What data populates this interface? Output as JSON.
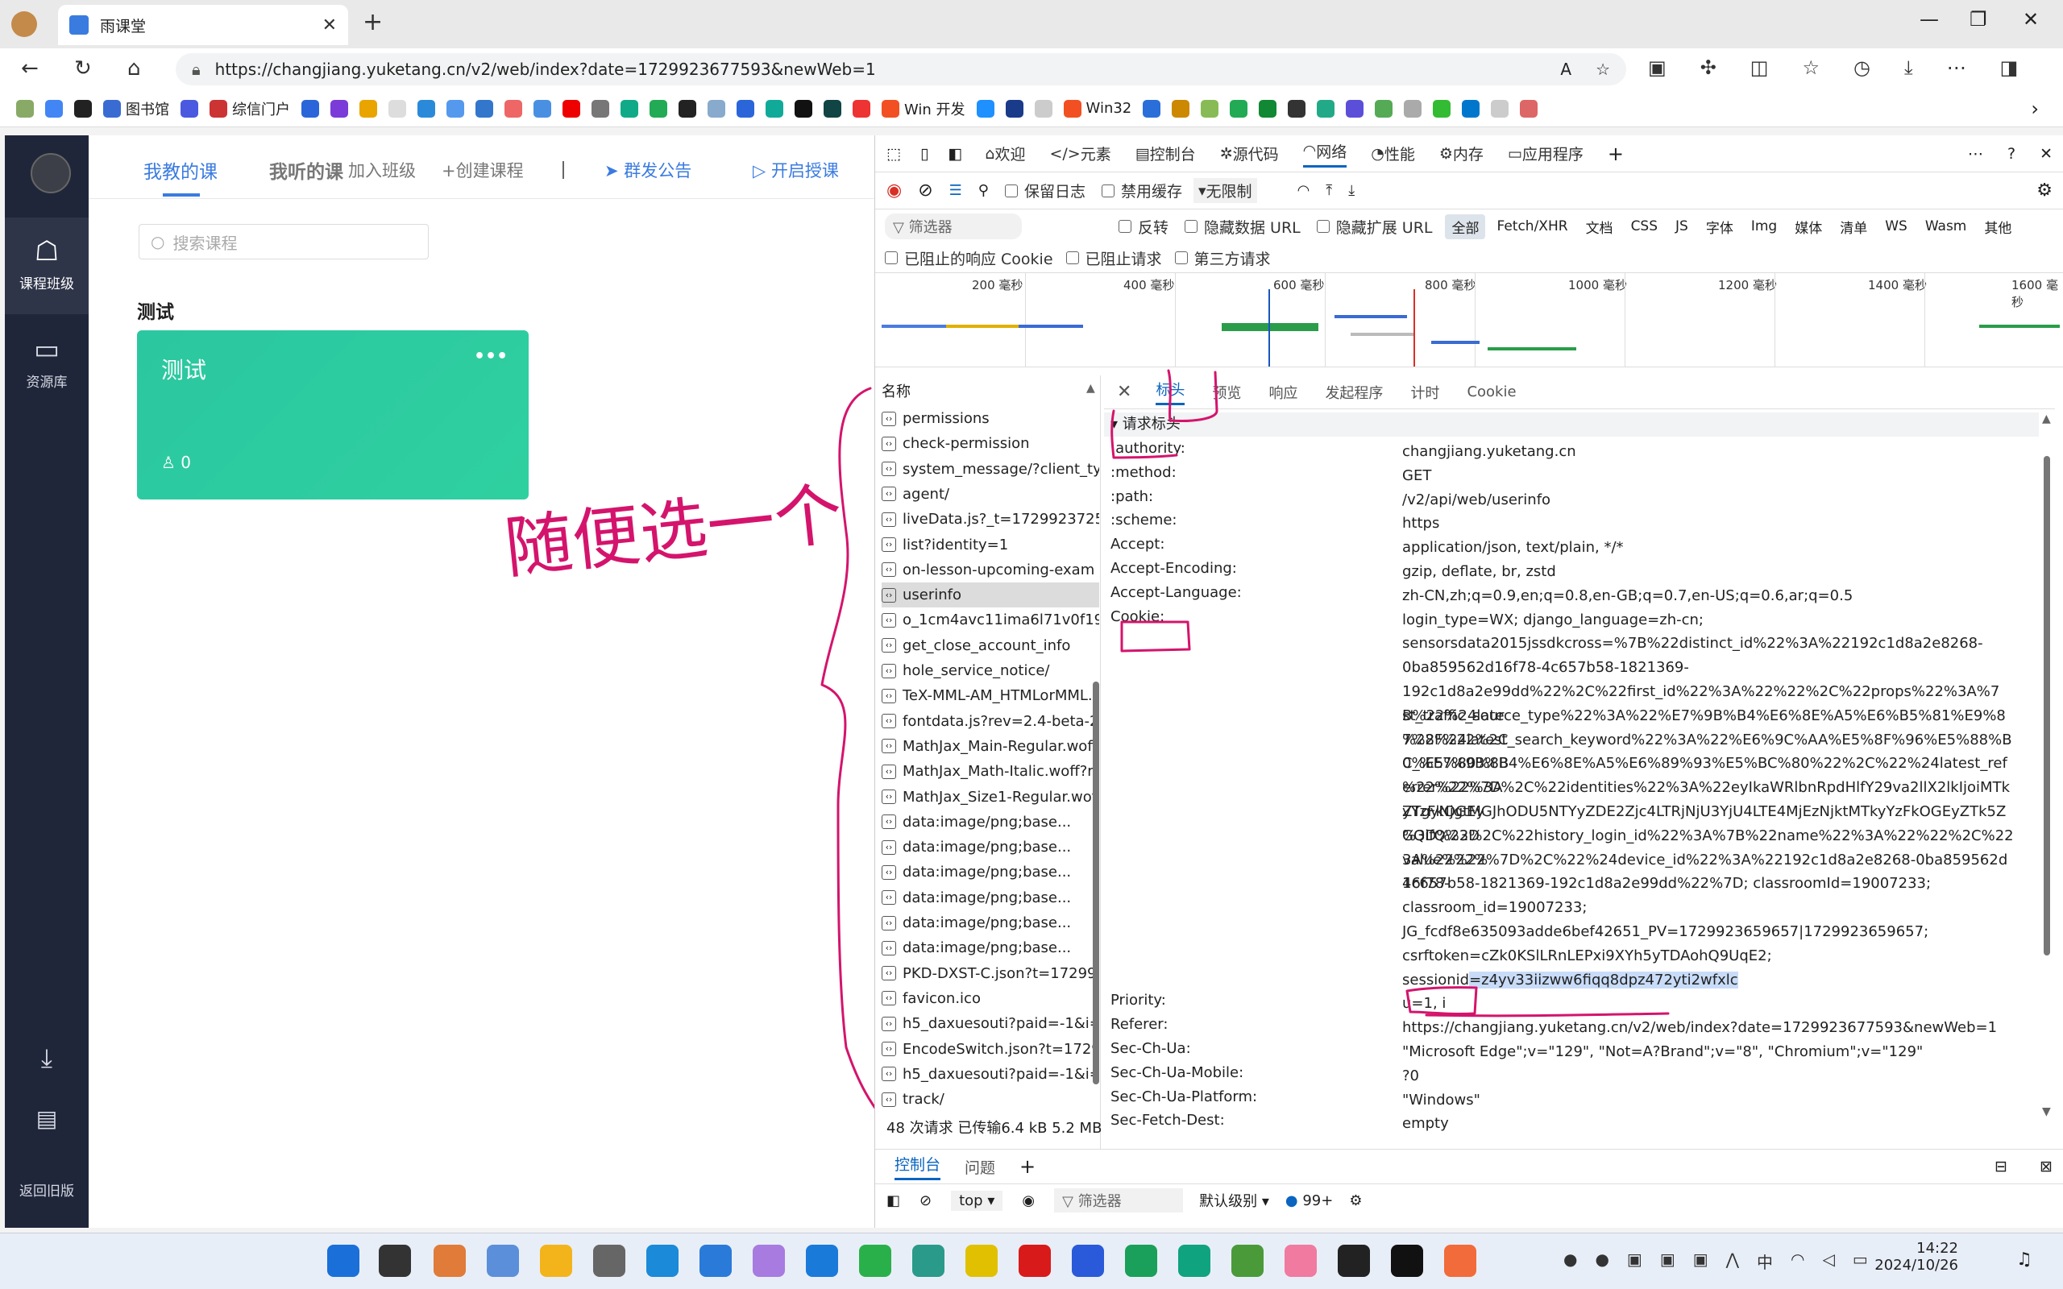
{
  "browser": {
    "tab_title": "雨课堂",
    "url": "https://changjiang.yuketang.cn/v2/web/index?date=1729923677593&newWeb=1",
    "bookmarks": [
      "图书馆",
      "综信门户",
      "Win 开发",
      "Win32"
    ]
  },
  "sidebar": {
    "items": [
      {
        "label": "课程班级"
      },
      {
        "label": "资源库"
      }
    ],
    "back_label": "返回旧版"
  },
  "main": {
    "tabs": [
      "我教的课",
      "我听的课",
      "加入班级",
      "+创建课程",
      "群发公告",
      "开启授课"
    ],
    "search_placeholder": "搜索课程",
    "section_title": "测试",
    "card": {
      "title": "测试",
      "more": "•••",
      "count": "0"
    }
  },
  "annotation": {
    "text": "随便选一个"
  },
  "devtools": {
    "tabs": [
      "欢迎",
      "元素",
      "控制台",
      "源代码",
      "网络",
      "性能",
      "内存",
      "应用程序"
    ],
    "toolbar": {
      "preserve_log": "保留日志",
      "disable_cache": "禁用缓存",
      "throttle": "无限制"
    },
    "filter": {
      "placeholder": "筛选器",
      "invert": "反转",
      "hide_data_url": "隐藏数据 URL",
      "hide_ext_url": "隐藏扩展 URL",
      "types": [
        "全部",
        "Fetch/XHR",
        "文档",
        "CSS",
        "JS",
        "字体",
        "Img",
        "媒体",
        "清单",
        "WS",
        "Wasm",
        "其他"
      ]
    },
    "options": [
      "已阻止的响应 Cookie",
      "已阻止请求",
      "第三方请求"
    ],
    "timeline_labels": [
      "200 毫秒",
      "400 毫秒",
      "600 毫秒",
      "800 毫秒",
      "1000 毫秒",
      "1200 毫秒",
      "1400 毫秒",
      "1600 毫秒"
    ],
    "list_header": "名称",
    "requests": [
      "permissions",
      "check-permission",
      "system_message/?client_typ...",
      "agent/",
      "liveData.js?_t=17299237253...",
      "list?identity=1",
      "on-lesson-upcoming-exam",
      "userinfo",
      "o_1cm4avc11ima6l71v0f19l...",
      "get_close_account_info",
      "hole_service_notice/",
      "TeX-MML-AM_HTMLorMML...",
      "fontdata.js?rev=2.4-beta-2",
      "MathJax_Main-Regular.woff...",
      "MathJax_Math-Italic.woff?re...",
      "MathJax_Size1-Regular.woff...",
      "data:image/png;base...",
      "data:image/png;base...",
      "data:image/png;base...",
      "data:image/png;base...",
      "data:image/png;base...",
      "data:image/png;base...",
      "PKD-DXST-C.json?t=172992...",
      "favicon.ico",
      "h5_daxuesouti?paid=-1&i=...",
      "EncodeSwitch.json?t=17299...",
      "h5_daxuesouti?paid=-1&i=...",
      "track/"
    ],
    "status": "48 次请求  已传输6.4 kB  5.2 MB 条",
    "detail_tabs": [
      "标头",
      "预览",
      "响应",
      "发起程序",
      "计时",
      "Cookie"
    ],
    "section": "请求标头",
    "headers": [
      {
        "name": ":authority:",
        "value": "changjiang.yuketang.cn"
      },
      {
        "name": ":method:",
        "value": "GET"
      },
      {
        "name": ":path:",
        "value": "/v2/api/web/userinfo"
      },
      {
        "name": ":scheme:",
        "value": "https"
      },
      {
        "name": "Accept:",
        "value": "application/json, text/plain, */*"
      },
      {
        "name": "Accept-Encoding:",
        "value": "gzip, deflate, br, zstd"
      },
      {
        "name": "Accept-Language:",
        "value": "zh-CN,zh;q=0.9,en;q=0.8,en-GB;q=0.7,en-US;q=0.6,ar;q=0.5"
      }
    ],
    "cookie_name": "Cookie:",
    "cookie_lines": [
      "login_type=WX; django_language=zh-cn;",
      "sensorsdata2015jssdkcross=%7B%22distinct_id%22%3A%22192c1d8a2e8268-",
      "0ba859562d16f78-4c657b58-1821369-",
      "192c1d8a2e99dd%22%2C%22first_id%22%3A%22%22%2C%22props%22%3A%7B%22%24late",
      "st_traffic_source_type%22%3A%22%E7%9B%B4%E6%8E%A5%E6%B5%81%E9%87%8F%22%2C",
      "%22%24latest_search_keyword%22%3A%22%E6%9C%AA%E5%8F%96%E5%88%B0%E5%80%8B",
      "C_%E7%9B%B4%E6%8E%A5%E6%89%93%E5%BC%80%22%2C%22%24latest_referrer%22%3A",
      "%22%22%7D%2C%22identities%22%3A%22eyIkaWRlbnRpdHlfY29va2llX2lkIjoiMTkyYzFkOGEy",
      "ZTgyNjgtMGJhODU5NTYyZDE2Zjc4LTRjNjU3YjU4LTE4MjEzNjktMTkyYzFkOGEyZTk5ZGQifQ%3D",
      "%3D%22%2C%22history_login_id%22%3A%7B%22name%22%3A%22%22%2C%22value%22%",
      "3A%22%22%7D%2C%22%24device_id%22%3A%22192c1d8a2e8268-0ba859562d16f78-",
      "4c657b58-1821369-192c1d8a2e99dd%22%7D; classroomId=19007233;",
      "classroom_id=19007233;",
      "JG_fcdf8e635093adde6bef42651_PV=1729923659657|1729923659657;",
      "csrftoken=cZk0KSlLRnLEPxi9XYh5yTDAohQ9UqE2;"
    ],
    "session_label": "sessionid",
    "session_value": "=z4yv33iizww6fiqq8dpz472yti2wfxlc",
    "after_session": "u=1, i",
    "headers2": [
      {
        "name": "Priority:",
        "value": ""
      },
      {
        "name": "Referer:",
        "value": "https://changjiang.yuketang.cn/v2/web/index?date=1729923677593&newWeb=1"
      },
      {
        "name": "Sec-Ch-Ua:",
        "value": "\"Microsoft Edge\";v=\"129\", \"Not=A?Brand\";v=\"8\", \"Chromium\";v=\"129\""
      },
      {
        "name": "Sec-Ch-Ua-Mobile:",
        "value": "?0"
      },
      {
        "name": "Sec-Ch-Ua-Platform:",
        "value": "\"Windows\""
      },
      {
        "name": "Sec-Fetch-Dest:",
        "value": "empty"
      }
    ],
    "drawer_tabs": [
      "控制台",
      "问题"
    ],
    "console_bar": {
      "context": "top",
      "filter": "筛选器",
      "level": "默认级别",
      "count": "99+"
    }
  },
  "taskbar": {
    "time": "14:22",
    "date": "2024/10/26",
    "ime": "中"
  }
}
